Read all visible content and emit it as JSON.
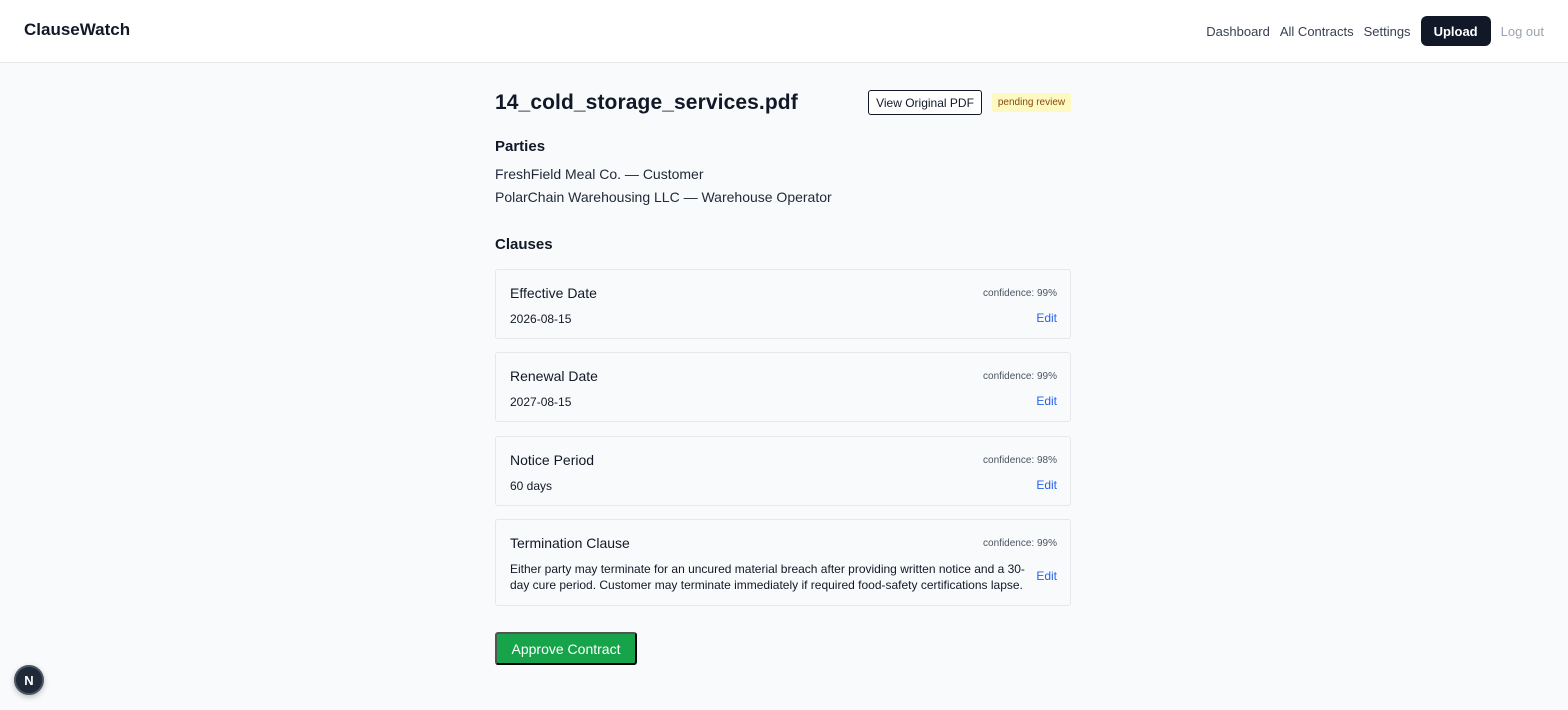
{
  "header": {
    "brand": "ClauseWatch",
    "nav": {
      "dashboard": "Dashboard",
      "all_contracts": "All Contracts",
      "settings": "Settings",
      "upload": "Upload",
      "logout": "Log out"
    }
  },
  "document": {
    "title": "14_cold_storage_services.pdf",
    "view_pdf_label": "View Original PDF",
    "status": "pending review"
  },
  "parties": {
    "heading": "Parties",
    "items": [
      "FreshField Meal Co. — Customer",
      "PolarChain Warehousing LLC — Warehouse Operator"
    ]
  },
  "clauses": {
    "heading": "Clauses",
    "edit_label": "Edit",
    "items": [
      {
        "name": "Effective Date",
        "confidence": "confidence: 99%",
        "value": "2026-08-15"
      },
      {
        "name": "Renewal Date",
        "confidence": "confidence: 99%",
        "value": "2027-08-15"
      },
      {
        "name": "Notice Period",
        "confidence": "confidence: 98%",
        "value": "60 days"
      },
      {
        "name": "Termination Clause",
        "confidence": "confidence: 99%",
        "value": "Either party may terminate for an uncured material breach after providing written notice and a 30-day cure period. Customer may terminate immediately if required food-safety certifications lapse."
      }
    ]
  },
  "actions": {
    "approve_label": "Approve Contract"
  },
  "dev_badge": {
    "letter": "N",
    "icon": "nextjs-icon"
  },
  "colors": {
    "primary_dark": "#111827",
    "approve_green": "#16a34a",
    "edit_link_blue": "#2563eb",
    "pending_badge_bg": "#fef9c3",
    "pending_badge_text": "#854d0e"
  }
}
